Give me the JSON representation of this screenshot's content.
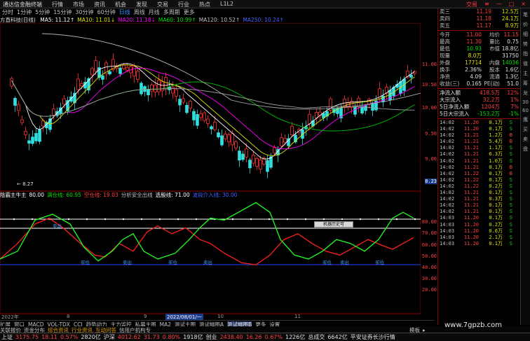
{
  "title_bar": {
    "app": "通达信金融终端",
    "menus": [
      "行情",
      "市场",
      "资讯",
      "机会",
      "发现",
      "交易",
      "行业",
      "热点",
      "L1L2"
    ],
    "controls": [
      "交易",
      "≡",
      "—",
      "□",
      "×"
    ]
  },
  "period_bar": {
    "items": [
      "分时",
      "1分钟",
      "5分钟",
      "15分钟",
      "30分钟",
      "60分钟",
      "日线",
      "周线",
      "月线",
      "多周期",
      "更多"
    ],
    "active": "日线"
  },
  "ma_bar": {
    "stock": "方直科技(日线)",
    "items": [
      {
        "label": "MA5: 11.12↑",
        "color": "#ffffff"
      },
      {
        "label": "MA10: 11.01↓",
        "color": "#e0e000"
      },
      {
        "label": "MA20: 11.18↓",
        "color": "#ff00ff"
      },
      {
        "label": "MA60: 10.99↑",
        "color": "#00e000"
      },
      {
        "label": "MA120: 10.52↑",
        "color": "#c0c0c0"
      },
      {
        "label": "MA250: 10.24↑",
        "color": "#4060ff"
      }
    ]
  },
  "price_axis": [
    "11.00",
    "10.50",
    "10.00",
    "9.50",
    "9.00"
  ],
  "price_axis_current": "8.23",
  "low_marker": "8.27",
  "indicator": {
    "items": [
      {
        "label": "陰霸主牛主",
        "color": "#ffffff"
      },
      {
        "label": "80.00",
        "color": "#ffffff"
      },
      {
        "label": "满仓线: 60.95",
        "color": "#00e000"
      },
      {
        "label": "空仓线: 19.03",
        "color": "#ff4040"
      },
      {
        "label": "分析安全出线",
        "color": "#c0c0c0"
      },
      {
        "label": "选股线: 71.00",
        "color": "#ffffff"
      },
      {
        "label": "波段介入线: 30.00",
        "color": "#4060ff"
      }
    ],
    "axis": [
      "80.00",
      "70.00",
      "60.00",
      "50.00",
      "40.00",
      "30.00",
      "20.00"
    ],
    "labels_blue": [
      "卖出",
      "买位",
      "卖出",
      "买位",
      "卖出",
      "买位",
      "卖出",
      "买位"
    ],
    "float_box": "机器历史可"
  },
  "date_axis": {
    "labels": [
      "2022年",
      "8",
      "9",
      "10",
      "11"
    ],
    "highlight": "2022/08/01/一"
  },
  "quotes": {
    "asks": [
      {
        "k": "卖三",
        "p": "11.19",
        "v": "12.5万"
      },
      {
        "k": "卖四",
        "p": "11.18",
        "v": "24.1万"
      },
      {
        "k": "卖五",
        "p": "11.17",
        "v": "8.9万"
      }
    ],
    "stats": [
      {
        "k": "今开",
        "v": "11.00",
        "k2": "均价",
        "v2": "11.15"
      },
      {
        "k": "最高",
        "v": "11.30",
        "k2": "量比",
        "v2": "0.75"
      },
      {
        "k": "最低",
        "v": "10.93",
        "k2": "市值",
        "v2": "18.8亿"
      },
      {
        "k": "现量",
        "v": "8.0万",
        "k2": "",
        "v2": "31750"
      },
      {
        "k": "外盘",
        "v": "17714",
        "k2": "内盘",
        "v2": "14036"
      },
      {
        "k": "换手",
        "v": "2.36%",
        "k2": "股本",
        "v2": "1.6亿"
      },
      {
        "k": "净资",
        "v": "4.09",
        "k2": "流通",
        "v2": "1.3亿"
      },
      {
        "k": "收益(三)",
        "v": "0.165",
        "k2": "PE(动)",
        "v2": "51.0"
      }
    ],
    "flows": [
      {
        "k": "净流入额",
        "v": "418.5万",
        "d": "12%",
        "c": "red"
      },
      {
        "k": "大宗流入",
        "v": "32.2万",
        "d": "1%",
        "c": "red"
      },
      {
        "k": "5日净流入额",
        "v": "1204万",
        "d": "7%",
        "c": "red"
      },
      {
        "k": "5日大宗流入",
        "v": "-153.2万",
        "d": "-1%",
        "c": "green"
      }
    ],
    "ticks": [
      {
        "t": "14:02",
        "p": "11.20",
        "q": "0.1万",
        "d": "S"
      },
      {
        "t": "14:02",
        "p": "11.20",
        "q": "0.1万",
        "d": "S"
      },
      {
        "t": "14:02",
        "p": "11.21",
        "q": "1.2万",
        "d": "B"
      },
      {
        "t": "14:02",
        "p": "11.21",
        "q": "5.4万",
        "d": "B"
      },
      {
        "t": "14:02",
        "p": "11.21",
        "q": "1.1万",
        "d": "S"
      },
      {
        "t": "14:02",
        "p": "11.21",
        "q": "6.3万",
        "d": "S"
      },
      {
        "t": "14:02",
        "p": "11.21",
        "q": "1.0万",
        "d": "S"
      },
      {
        "t": "14:02",
        "p": "11.21",
        "q": "0.1万",
        "d": "B"
      },
      {
        "t": "14:02",
        "p": "11.22",
        "q": "0.1万",
        "d": "B"
      },
      {
        "t": "14:02",
        "p": "11.22",
        "q": "0.1万",
        "d": "S"
      },
      {
        "t": "14:02",
        "p": "11.22",
        "q": "0.2万",
        "d": "S"
      },
      {
        "t": "14:02",
        "p": "11.21",
        "q": "0.1万",
        "d": "S"
      },
      {
        "t": "14:02",
        "p": "11.21",
        "q": "0.3万",
        "d": "S"
      },
      {
        "t": "14:02",
        "p": "11.21",
        "q": "0.1万",
        "d": "S"
      },
      {
        "t": "14:02",
        "p": "11.21",
        "q": "0.1万",
        "d": "S"
      },
      {
        "t": "14:03",
        "p": "11.20",
        "q": "0.1万",
        "d": "S"
      },
      {
        "t": "14:03",
        "p": "11.20",
        "q": "0.2万",
        "d": "S"
      },
      {
        "t": "14:03",
        "p": "11.20",
        "q": "0.6万",
        "d": "S"
      },
      {
        "t": "14:03",
        "p": "11.20",
        "q": "2.1万",
        "d": "S"
      },
      {
        "t": "14:03",
        "p": "11.20",
        "q": "0.1万",
        "d": "S"
      }
    ]
  },
  "side_tabs": [
    "笔",
    "价",
    "细",
    "势",
    "指",
    "值",
    "主",
    "筹",
    "龙",
    "30",
    "60",
    "鹰",
    "买",
    "卖",
    "盘"
  ],
  "tab_bar": {
    "items": [
      "扩展",
      "窗口",
      "MACD",
      "VOL-TDX",
      "CCI",
      "趋势动力",
      "主力监控",
      "私募主图",
      "MA2",
      "测试主图",
      "测试幅图A",
      "测试幅图B",
      "更多",
      "设置"
    ],
    "active": "测试幅图B"
  },
  "func_bar": {
    "items": [
      {
        "label": "关联报价",
        "hl": false
      },
      {
        "label": "资金分布",
        "hl": false
      },
      {
        "label": "综合资讯",
        "hl": true
      },
      {
        "label": "行业资讯",
        "hl": true
      },
      {
        "label": "互动问答",
        "hl": true
      },
      {
        "label": "信用户机构专",
        "hl": false
      }
    ],
    "right": [
      "模板",
      "▸"
    ]
  },
  "status": {
    "items": [
      {
        "label": "上证",
        "v1": "3175.75",
        "v2": "18.11",
        "v3": "0.57%",
        "v4": "2820亿"
      },
      {
        "label": "沪深",
        "v1": "4012.62",
        "v2": "31.73",
        "v3": "0.80%",
        "v4": "1918亿"
      },
      {
        "label": "创业",
        "v1": "2438.40",
        "v2": "16.26",
        "v3": "0.67%",
        "v4": "1226亿"
      }
    ],
    "total_label": "总成交",
    "total_value": "6642亿",
    "broker": "平安证券长沙行情"
  },
  "watermark": "www.7gpzb.com"
}
